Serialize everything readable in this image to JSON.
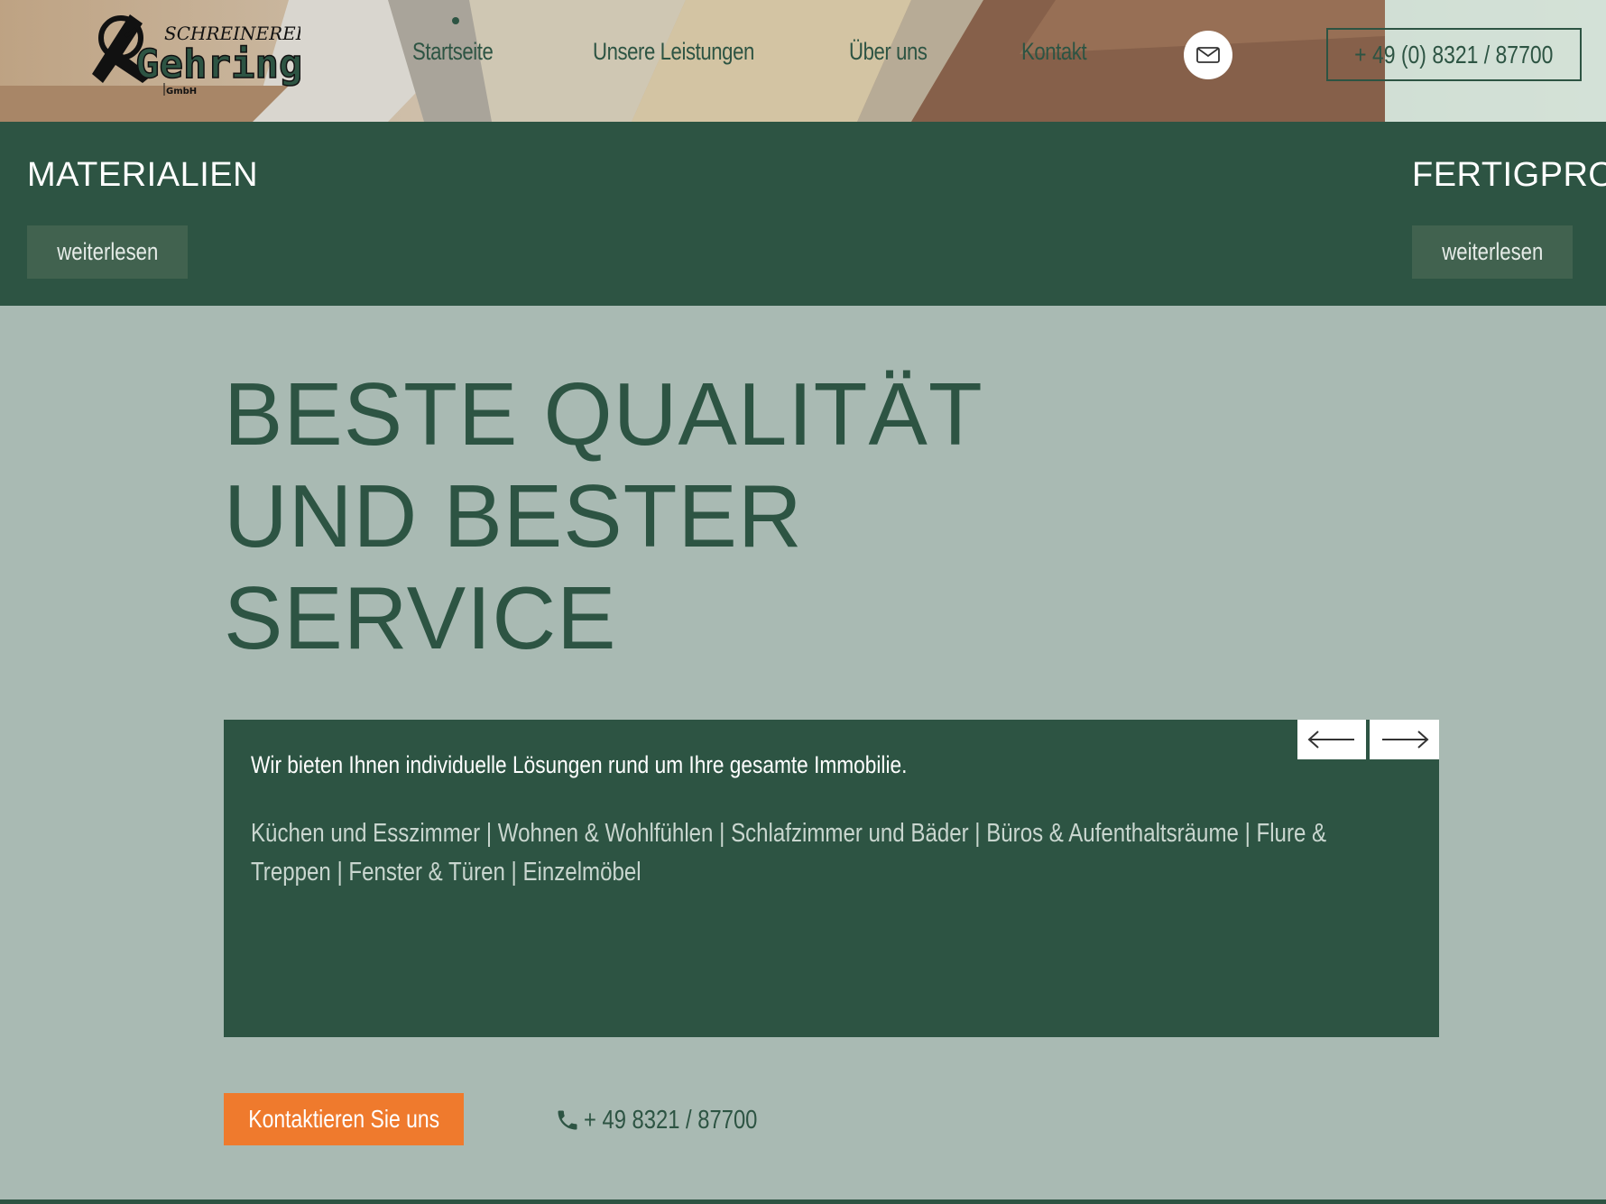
{
  "header": {
    "logo": {
      "line1": "SCHREINEREI",
      "line2": "Gehring",
      "line3": "GmbH"
    },
    "nav": [
      {
        "label": "Startseite"
      },
      {
        "label": "Unsere Leistungen"
      },
      {
        "label": "Über uns"
      },
      {
        "label": "Kontakt"
      }
    ],
    "mail_icon": "mail-icon",
    "phone_button": "+ 49 (0) 8321 / 87700"
  },
  "categories": [
    {
      "title": "MATERIALIEN",
      "button": "weiterlesen"
    },
    {
      "title": "FERTIGPRODUKTE",
      "button": "weiterlesen"
    }
  ],
  "hero": {
    "title_lines": [
      "BESTE QUALITÄT",
      "UND BESTER",
      "SERVICE"
    ],
    "lead": "Wir bieten Ihnen individuelle Lösungen rund um Ihre gesamte Immobilie.",
    "services": "Küchen und Esszimmer | Wohnen & Wohlfühlen | Schlafzimmer und Bäder | Büros & Aufenthaltsräume | Flure & Treppen | Fenster & Türen | Einzelmöbel",
    "prev_icon": "arrow-left-icon",
    "next_icon": "arrow-right-icon"
  },
  "cta": {
    "button": "Kontaktieren Sie uns",
    "phone": "+ 49 8321 / 87700",
    "phone_icon": "phone-icon"
  },
  "colors": {
    "primary_green": "#2d5443",
    "background": "#a9bab3",
    "accent_orange": "#ef7a2d",
    "button_green": "#41624f"
  }
}
